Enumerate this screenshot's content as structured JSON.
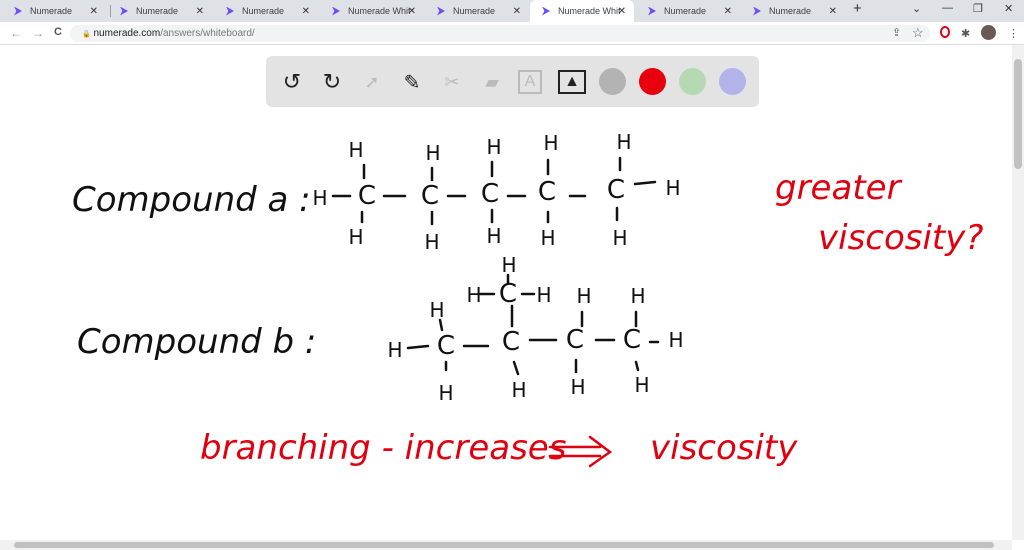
{
  "tabs": [
    {
      "label": "Numerade"
    },
    {
      "label": "Numerade"
    },
    {
      "label": "Numerade"
    },
    {
      "label": "Numerade White"
    },
    {
      "label": "Numerade"
    },
    {
      "label": "Numerade White",
      "active": true
    },
    {
      "label": "Numerade"
    },
    {
      "label": "Numerade"
    }
  ],
  "address": {
    "domain": "numerade.com",
    "path": "/answers/whiteboard/"
  },
  "icons": {
    "close": "✕",
    "new_tab": "+",
    "back": "←",
    "forward": "→",
    "reload": "C",
    "lock": "🔒",
    "share": "⇪",
    "star": "☆",
    "extensions": "✱",
    "menu": "⋮",
    "minimize": "—",
    "restore": "❐",
    "win_close": "✕",
    "tab_search": "⌄"
  },
  "toolbar": {
    "colors": {
      "gray": "#b3b3b3",
      "red": "#e8000e",
      "green": "#b5d9b3",
      "purple": "#b3b3ea"
    }
  },
  "whiteboard": {
    "compound_a_label": "Compound a :",
    "compound_b_label": "Compound b :",
    "note_line1": "greater",
    "note_line2": "viscosity?",
    "bottom_left": "branching - increases",
    "arrow": "⟹",
    "bottom_right": "viscosity",
    "atoms": {
      "carbon": "C",
      "hydrogen": "H"
    }
  }
}
